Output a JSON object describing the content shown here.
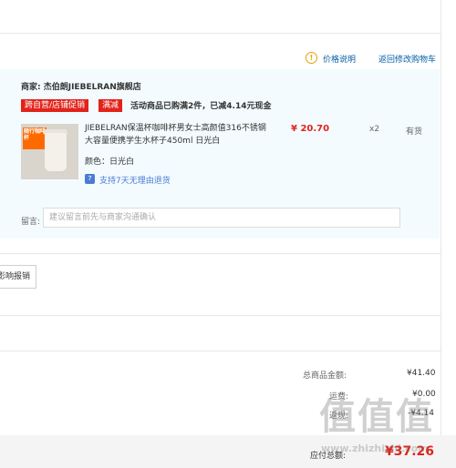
{
  "header": {
    "price_note_icon": "warning-circle-icon",
    "price_note": "价格说明",
    "back_to_cart": "返回修改购物车"
  },
  "shop": {
    "merchant": "商家: 杰伯朗JIEBELRAN旗舰店",
    "tags": [
      "跨自营/店铺促销",
      "满减"
    ],
    "promo": "活动商品已购满2件，已减4.14元现金",
    "item": {
      "thumb_badge": "随行咖啡杯",
      "title": "JIEBELRAN保温杯咖啡杯男女士高颜值316不锈钢大容量便携学生水杯子450ml 日光白",
      "color": "颜色：日光白",
      "return_icon": "return-7day-icon",
      "return_text": "支持7天无理由退货",
      "price": "¥ 20.70",
      "qty": "x2",
      "stock": "有货"
    },
    "note_label": "留言:",
    "note_placeholder": "建议留言前先与商家沟通确认"
  },
  "invoice": {
    "button": "影响报销"
  },
  "summary": {
    "total_goods_label": "总商品金额:",
    "total_goods": "¥41.40",
    "shipping_label": "运费:",
    "shipping": "¥0.00",
    "discount_label": "返现:",
    "discount": "-¥4.14"
  },
  "footer": {
    "payable_label": "应付总额:",
    "payable": "¥37.26"
  },
  "watermark": {
    "glyphs": "值值值",
    "site": "www.zhizhizhi.com"
  },
  "colors": {
    "accent_red": "#e2231a",
    "link_blue": "#005ea7",
    "panel_bg": "#f3fbfe"
  }
}
